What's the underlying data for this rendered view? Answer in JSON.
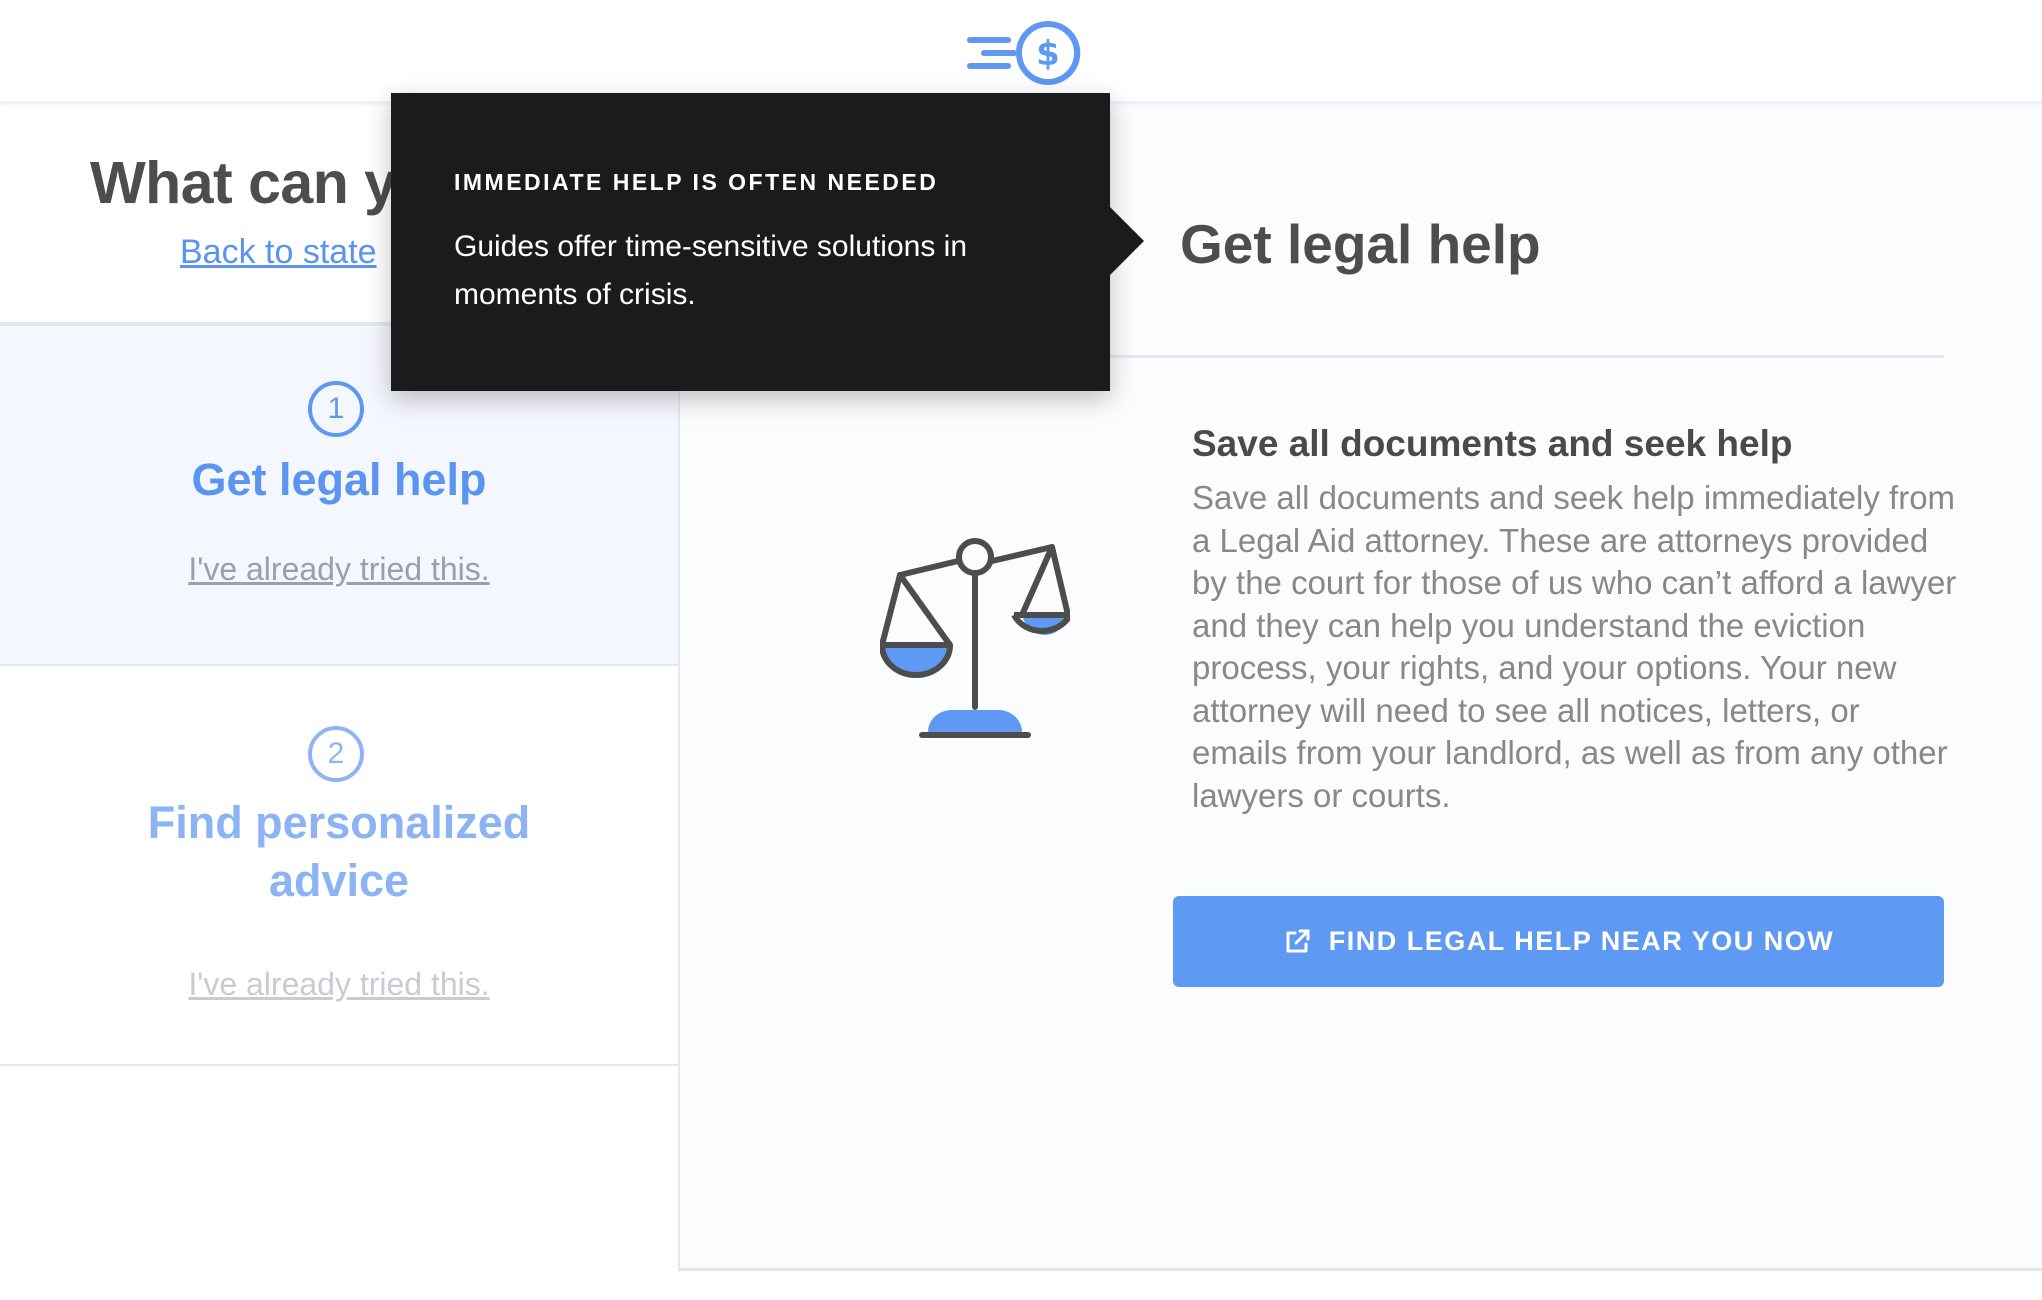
{
  "header": {
    "logo_icon": "coin-dollar-speed-icon",
    "brand_color": "#5f98f2"
  },
  "left": {
    "title": "What can you do?",
    "back_link": "Back to state",
    "steps": [
      {
        "number": "1",
        "title": "Get legal help",
        "link": "I've already tried this."
      },
      {
        "number": "2",
        "title": "Find personalized advice",
        "link": "I've already tried this."
      }
    ]
  },
  "main": {
    "title": "Get legal help",
    "icon": "scale-of-justice-icon",
    "heading": "Save all documents and seek help",
    "body": "Save all documents and seek help immediately from a Legal Aid attorney. These are attorneys provided by the court for those of us who can’t afford a lawyer and they can help you understand the eviction process, your rights, and your options. Your new attorney will need to see all notices, letters, or emails from your landlord, as well as from any other lawyers or courts.",
    "cta_label": "FIND LEGAL HELP NEAR YOU NOW",
    "cta_icon": "external-link-icon"
  },
  "tooltip": {
    "title": "IMMEDIATE HELP IS OFTEN NEEDED",
    "body": "Guides offer time-sensitive solutions in moments of crisis."
  }
}
